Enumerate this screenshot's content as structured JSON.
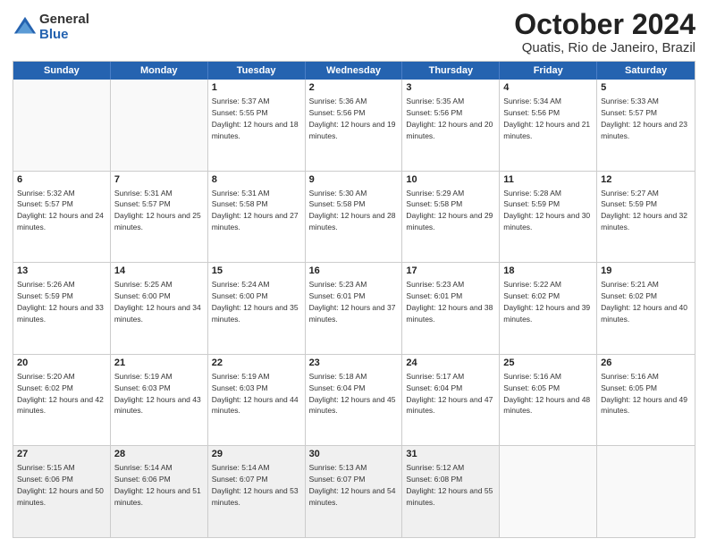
{
  "logo": {
    "general": "General",
    "blue": "Blue"
  },
  "title": "October 2024",
  "location": "Quatis, Rio de Janeiro, Brazil",
  "header_days": [
    "Sunday",
    "Monday",
    "Tuesday",
    "Wednesday",
    "Thursday",
    "Friday",
    "Saturday"
  ],
  "weeks": [
    [
      {
        "day": "",
        "sunrise": "",
        "sunset": "",
        "daylight": "",
        "empty": true
      },
      {
        "day": "",
        "sunrise": "",
        "sunset": "",
        "daylight": "",
        "empty": true
      },
      {
        "day": "1",
        "sunrise": "Sunrise: 5:37 AM",
        "sunset": "Sunset: 5:55 PM",
        "daylight": "Daylight: 12 hours and 18 minutes."
      },
      {
        "day": "2",
        "sunrise": "Sunrise: 5:36 AM",
        "sunset": "Sunset: 5:56 PM",
        "daylight": "Daylight: 12 hours and 19 minutes."
      },
      {
        "day": "3",
        "sunrise": "Sunrise: 5:35 AM",
        "sunset": "Sunset: 5:56 PM",
        "daylight": "Daylight: 12 hours and 20 minutes."
      },
      {
        "day": "4",
        "sunrise": "Sunrise: 5:34 AM",
        "sunset": "Sunset: 5:56 PM",
        "daylight": "Daylight: 12 hours and 21 minutes."
      },
      {
        "day": "5",
        "sunrise": "Sunrise: 5:33 AM",
        "sunset": "Sunset: 5:57 PM",
        "daylight": "Daylight: 12 hours and 23 minutes."
      }
    ],
    [
      {
        "day": "6",
        "sunrise": "Sunrise: 5:32 AM",
        "sunset": "Sunset: 5:57 PM",
        "daylight": "Daylight: 12 hours and 24 minutes."
      },
      {
        "day": "7",
        "sunrise": "Sunrise: 5:31 AM",
        "sunset": "Sunset: 5:57 PM",
        "daylight": "Daylight: 12 hours and 25 minutes."
      },
      {
        "day": "8",
        "sunrise": "Sunrise: 5:31 AM",
        "sunset": "Sunset: 5:58 PM",
        "daylight": "Daylight: 12 hours and 27 minutes."
      },
      {
        "day": "9",
        "sunrise": "Sunrise: 5:30 AM",
        "sunset": "Sunset: 5:58 PM",
        "daylight": "Daylight: 12 hours and 28 minutes."
      },
      {
        "day": "10",
        "sunrise": "Sunrise: 5:29 AM",
        "sunset": "Sunset: 5:58 PM",
        "daylight": "Daylight: 12 hours and 29 minutes."
      },
      {
        "day": "11",
        "sunrise": "Sunrise: 5:28 AM",
        "sunset": "Sunset: 5:59 PM",
        "daylight": "Daylight: 12 hours and 30 minutes."
      },
      {
        "day": "12",
        "sunrise": "Sunrise: 5:27 AM",
        "sunset": "Sunset: 5:59 PM",
        "daylight": "Daylight: 12 hours and 32 minutes."
      }
    ],
    [
      {
        "day": "13",
        "sunrise": "Sunrise: 5:26 AM",
        "sunset": "Sunset: 5:59 PM",
        "daylight": "Daylight: 12 hours and 33 minutes."
      },
      {
        "day": "14",
        "sunrise": "Sunrise: 5:25 AM",
        "sunset": "Sunset: 6:00 PM",
        "daylight": "Daylight: 12 hours and 34 minutes."
      },
      {
        "day": "15",
        "sunrise": "Sunrise: 5:24 AM",
        "sunset": "Sunset: 6:00 PM",
        "daylight": "Daylight: 12 hours and 35 minutes."
      },
      {
        "day": "16",
        "sunrise": "Sunrise: 5:23 AM",
        "sunset": "Sunset: 6:01 PM",
        "daylight": "Daylight: 12 hours and 37 minutes."
      },
      {
        "day": "17",
        "sunrise": "Sunrise: 5:23 AM",
        "sunset": "Sunset: 6:01 PM",
        "daylight": "Daylight: 12 hours and 38 minutes."
      },
      {
        "day": "18",
        "sunrise": "Sunrise: 5:22 AM",
        "sunset": "Sunset: 6:02 PM",
        "daylight": "Daylight: 12 hours and 39 minutes."
      },
      {
        "day": "19",
        "sunrise": "Sunrise: 5:21 AM",
        "sunset": "Sunset: 6:02 PM",
        "daylight": "Daylight: 12 hours and 40 minutes."
      }
    ],
    [
      {
        "day": "20",
        "sunrise": "Sunrise: 5:20 AM",
        "sunset": "Sunset: 6:02 PM",
        "daylight": "Daylight: 12 hours and 42 minutes."
      },
      {
        "day": "21",
        "sunrise": "Sunrise: 5:19 AM",
        "sunset": "Sunset: 6:03 PM",
        "daylight": "Daylight: 12 hours and 43 minutes."
      },
      {
        "day": "22",
        "sunrise": "Sunrise: 5:19 AM",
        "sunset": "Sunset: 6:03 PM",
        "daylight": "Daylight: 12 hours and 44 minutes."
      },
      {
        "day": "23",
        "sunrise": "Sunrise: 5:18 AM",
        "sunset": "Sunset: 6:04 PM",
        "daylight": "Daylight: 12 hours and 45 minutes."
      },
      {
        "day": "24",
        "sunrise": "Sunrise: 5:17 AM",
        "sunset": "Sunset: 6:04 PM",
        "daylight": "Daylight: 12 hours and 47 minutes."
      },
      {
        "day": "25",
        "sunrise": "Sunrise: 5:16 AM",
        "sunset": "Sunset: 6:05 PM",
        "daylight": "Daylight: 12 hours and 48 minutes."
      },
      {
        "day": "26",
        "sunrise": "Sunrise: 5:16 AM",
        "sunset": "Sunset: 6:05 PM",
        "daylight": "Daylight: 12 hours and 49 minutes."
      }
    ],
    [
      {
        "day": "27",
        "sunrise": "Sunrise: 5:15 AM",
        "sunset": "Sunset: 6:06 PM",
        "daylight": "Daylight: 12 hours and 50 minutes."
      },
      {
        "day": "28",
        "sunrise": "Sunrise: 5:14 AM",
        "sunset": "Sunset: 6:06 PM",
        "daylight": "Daylight: 12 hours and 51 minutes."
      },
      {
        "day": "29",
        "sunrise": "Sunrise: 5:14 AM",
        "sunset": "Sunset: 6:07 PM",
        "daylight": "Daylight: 12 hours and 53 minutes."
      },
      {
        "day": "30",
        "sunrise": "Sunrise: 5:13 AM",
        "sunset": "Sunset: 6:07 PM",
        "daylight": "Daylight: 12 hours and 54 minutes."
      },
      {
        "day": "31",
        "sunrise": "Sunrise: 5:12 AM",
        "sunset": "Sunset: 6:08 PM",
        "daylight": "Daylight: 12 hours and 55 minutes."
      },
      {
        "day": "",
        "sunrise": "",
        "sunset": "",
        "daylight": "",
        "empty": true
      },
      {
        "day": "",
        "sunrise": "",
        "sunset": "",
        "daylight": "",
        "empty": true
      }
    ]
  ]
}
